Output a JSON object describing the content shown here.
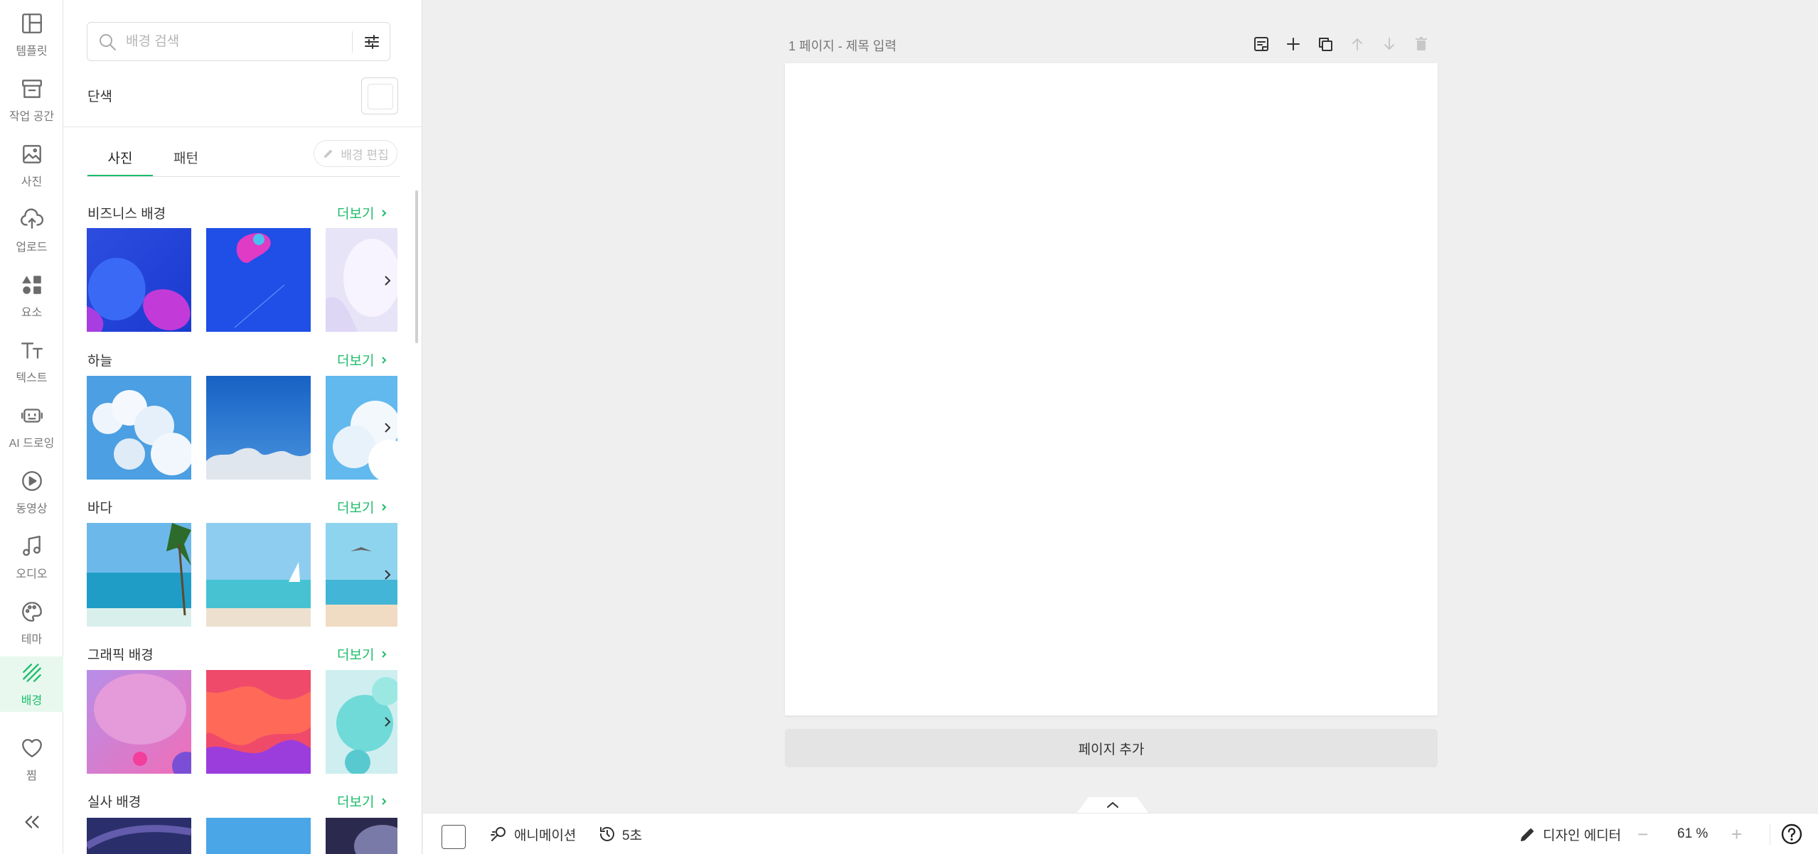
{
  "colors": {
    "accent": "#1ebd6b",
    "canvas_bg": "#efefef",
    "page_bg": "#ffffff"
  },
  "sidebar": {
    "items": [
      {
        "label": "템플릿",
        "icon": "template-icon"
      },
      {
        "label": "작업 공간",
        "icon": "archive-icon"
      },
      {
        "label": "사진",
        "icon": "image-icon"
      },
      {
        "label": "업로드",
        "icon": "cloud-upload-icon"
      },
      {
        "label": "요소",
        "icon": "shapes-icon"
      },
      {
        "label": "텍스트",
        "icon": "text-icon"
      },
      {
        "label": "AI 드로잉",
        "icon": "robot-icon"
      },
      {
        "label": "동영상",
        "icon": "play-icon"
      },
      {
        "label": "오디오",
        "icon": "music-icon"
      },
      {
        "label": "테마",
        "icon": "palette-icon"
      },
      {
        "label": "배경",
        "icon": "background-icon",
        "active": true
      },
      {
        "label": "찜",
        "icon": "heart-icon"
      }
    ],
    "collapse_icon": "double-chevron-left-icon"
  },
  "panel": {
    "search": {
      "placeholder": "배경 검색"
    },
    "solid_label": "단색",
    "tabs": [
      {
        "label": "사진",
        "active": true
      },
      {
        "label": "패턴"
      }
    ],
    "edit_button": "배경 편집",
    "more_label": "더보기",
    "sections": [
      {
        "title": "비즈니스 배경"
      },
      {
        "title": "하늘"
      },
      {
        "title": "바다"
      },
      {
        "title": "그래픽 배경"
      },
      {
        "title": "실사 배경"
      }
    ]
  },
  "canvas": {
    "page_title": "1 페이지 - 제목 입력",
    "tools": [
      "note-icon",
      "plus-icon",
      "duplicate-icon",
      "arrow-up-icon",
      "arrow-down-icon",
      "trash-icon"
    ],
    "add_page": "페이지 추가"
  },
  "bottom_bar": {
    "animation": "애니메이션",
    "duration": "5초",
    "design_editor": "디자인 에디터",
    "zoom_minus": "−",
    "zoom": "61 %",
    "zoom_plus": "+"
  }
}
